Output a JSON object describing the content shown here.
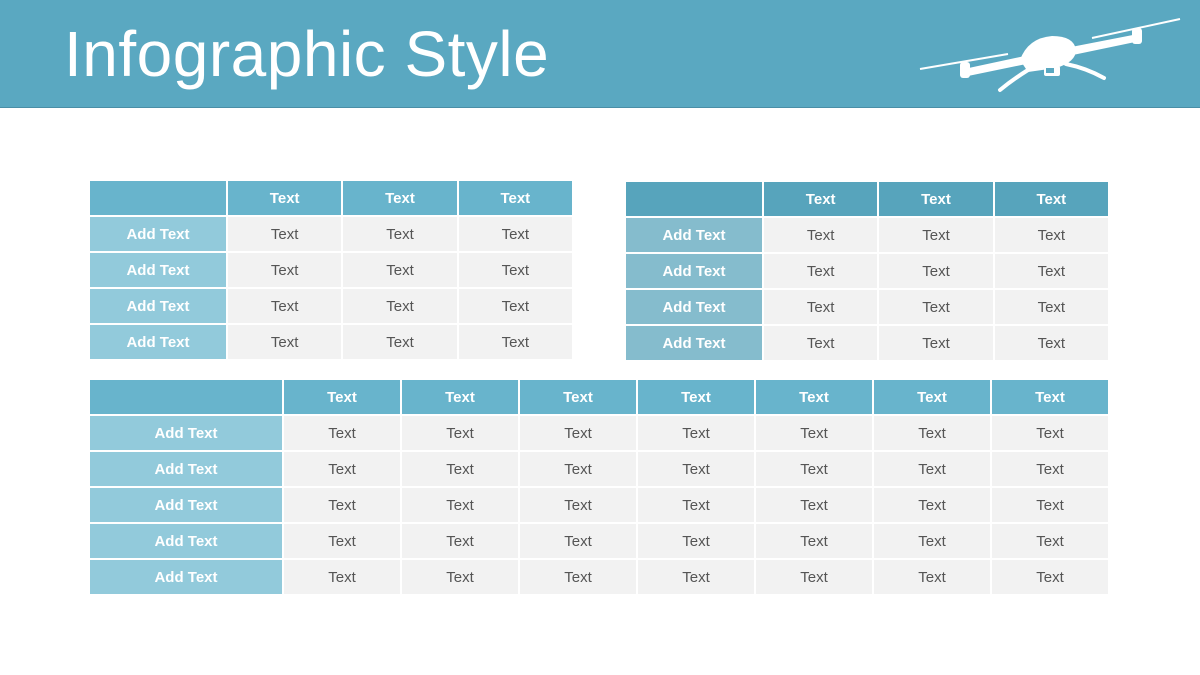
{
  "slide": {
    "title": "Infographic Style"
  },
  "colors": {
    "header_bg": "#5aa8c1",
    "table_header": "#68b4cc",
    "row_label": "#92cadb",
    "cell_bg": "#f2f2f2"
  },
  "icons": {
    "header": "drone-icon"
  },
  "table_top_left": {
    "headers": [
      "",
      "Text",
      "Text",
      "Text"
    ],
    "rows": [
      {
        "label": "Add Text",
        "cells": [
          "Text",
          "Text",
          "Text"
        ]
      },
      {
        "label": "Add Text",
        "cells": [
          "Text",
          "Text",
          "Text"
        ]
      },
      {
        "label": "Add Text",
        "cells": [
          "Text",
          "Text",
          "Text"
        ]
      },
      {
        "label": "Add Text",
        "cells": [
          "Text",
          "Text",
          "Text"
        ]
      }
    ]
  },
  "table_top_right": {
    "headers": [
      "",
      "Text",
      "Text",
      "Text"
    ],
    "rows": [
      {
        "label": "Add Text",
        "cells": [
          "Text",
          "Text",
          "Text"
        ]
      },
      {
        "label": "Add Text",
        "cells": [
          "Text",
          "Text",
          "Text"
        ]
      },
      {
        "label": "Add Text",
        "cells": [
          "Text",
          "Text",
          "Text"
        ]
      },
      {
        "label": "Add Text",
        "cells": [
          "Text",
          "Text",
          "Text"
        ]
      }
    ]
  },
  "table_bottom": {
    "headers": [
      "",
      "Text",
      "Text",
      "Text",
      "Text",
      "Text",
      "Text",
      "Text"
    ],
    "rows": [
      {
        "label": "Add Text",
        "cells": [
          "Text",
          "Text",
          "Text",
          "Text",
          "Text",
          "Text",
          "Text"
        ]
      },
      {
        "label": "Add Text",
        "cells": [
          "Text",
          "Text",
          "Text",
          "Text",
          "Text",
          "Text",
          "Text"
        ]
      },
      {
        "label": "Add Text",
        "cells": [
          "Text",
          "Text",
          "Text",
          "Text",
          "Text",
          "Text",
          "Text"
        ]
      },
      {
        "label": "Add Text",
        "cells": [
          "Text",
          "Text",
          "Text",
          "Text",
          "Text",
          "Text",
          "Text"
        ]
      },
      {
        "label": "Add Text",
        "cells": [
          "Text",
          "Text",
          "Text",
          "Text",
          "Text",
          "Text",
          "Text"
        ]
      }
    ]
  }
}
